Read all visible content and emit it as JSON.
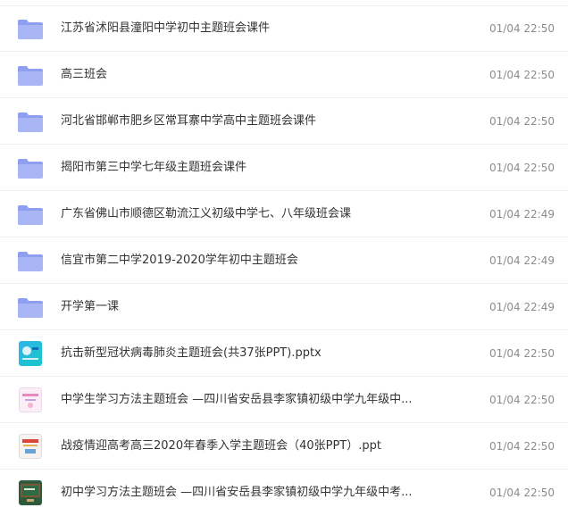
{
  "files": [
    {
      "name": "江苏省沭阳县潼阳中学初中主题班会课件",
      "time": "01/04 22:50",
      "icon": "folder-icon"
    },
    {
      "name": "高三班会",
      "time": "01/04 22:50",
      "icon": "folder-icon"
    },
    {
      "name": "河北省邯郸市肥乡区常耳寨中学高中主题班会课件",
      "time": "01/04 22:50",
      "icon": "folder-icon"
    },
    {
      "name": "揭阳市第三中学七年级主题班会课件",
      "time": "01/04 22:50",
      "icon": "folder-icon"
    },
    {
      "name": "广东省佛山市顺德区勒流江义初级中学七、八年级班会课",
      "time": "01/04 22:49",
      "icon": "folder-icon"
    },
    {
      "name": "信宜市第二中学2019-2020学年初中主题班会",
      "time": "01/04 22:49",
      "icon": "folder-icon"
    },
    {
      "name": "开学第一课",
      "time": "01/04 22:49",
      "icon": "folder-icon"
    },
    {
      "name": "抗击新型冠状病毒肺炎主题班会(共37张PPT).pptx",
      "time": "01/04 22:50",
      "icon": "pptx-thumbnail-icon"
    },
    {
      "name": "中学生学习方法主题班会 —四川省安岳县李家镇初级中学九年级中...",
      "time": "01/04 22:50",
      "icon": "ppt-thumbnail-icon"
    },
    {
      "name": "战疫情迎高考高三2020年春季入学主题班会（40张PPT）.ppt",
      "time": "01/04 22:50",
      "icon": "ppt-thumbnail-icon"
    },
    {
      "name": "初中学习方法主题班会 —四川省安岳县李家镇初级中学九年级中考...",
      "time": "01/04 22:50",
      "icon": "ppt-thumbnail-icon"
    }
  ]
}
